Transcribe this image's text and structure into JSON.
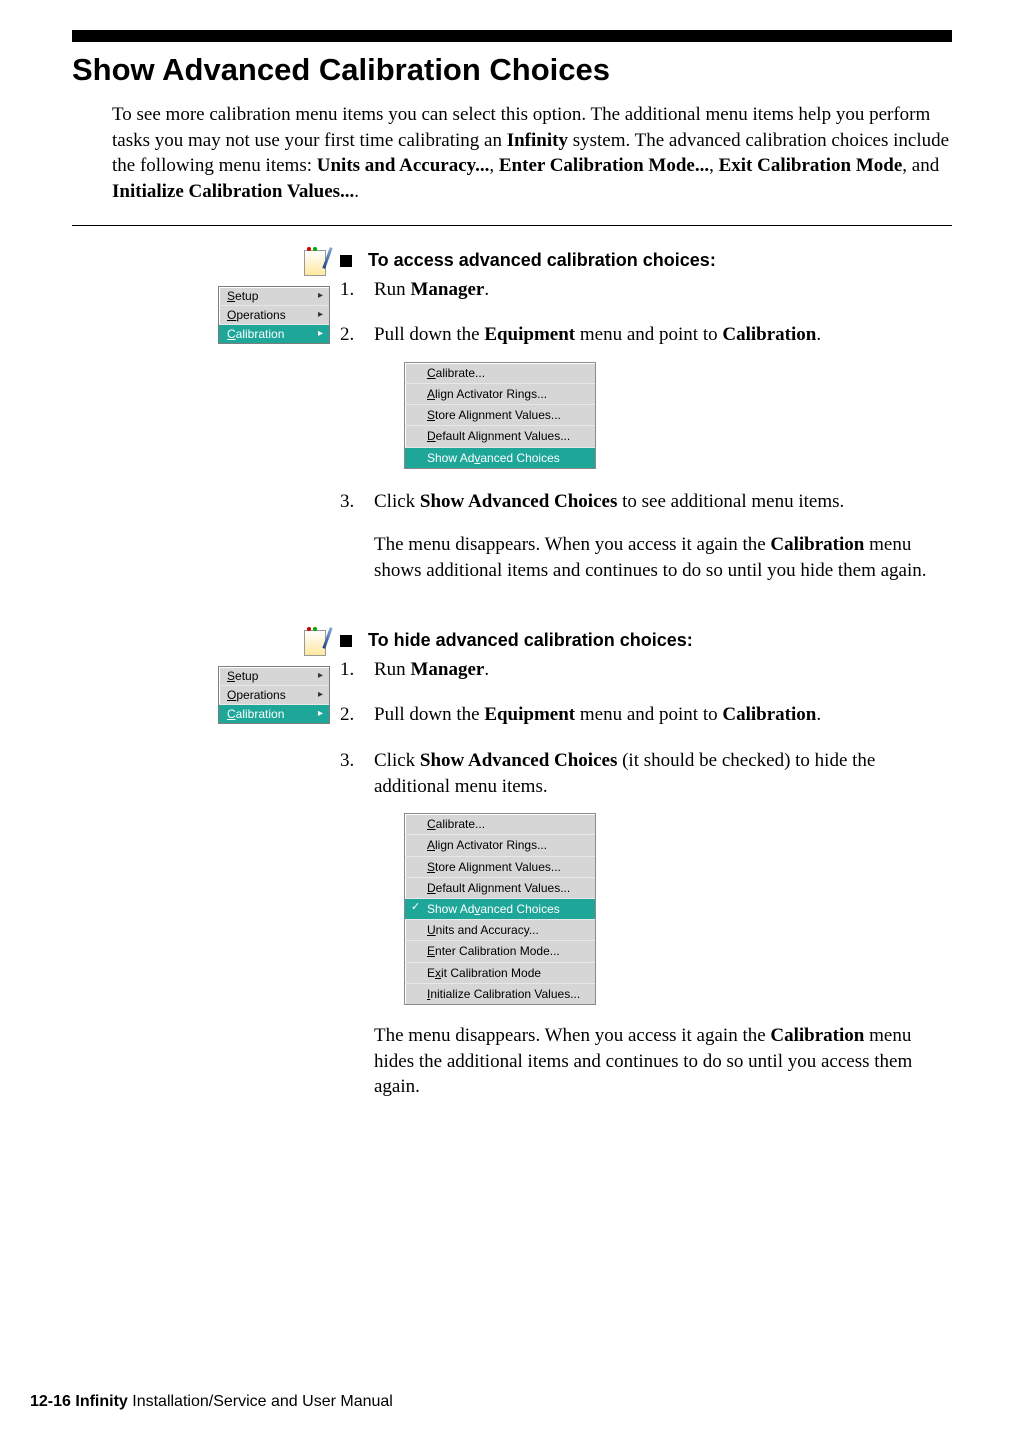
{
  "heading": "Show Advanced Calibration Choices",
  "intro": {
    "p1a": "To see more calibration menu items you can select this option. The additional menu items help you perform tasks you may not use your first time calibrating an ",
    "p1b": "Infinity",
    "p1c": " system. The advanced calibration choices include the following menu items: ",
    "m1": "Units and Accuracy...",
    "c1": ", ",
    "m2": "Enter Calibration Mode...",
    "c2": ", ",
    "m3": "Exit Calibration Mode",
    "c3": ", and ",
    "m4": "Initialize Calibration Values...",
    "c4": "."
  },
  "sideMenu": {
    "items": [
      "Setup",
      "Operations",
      "Calibration"
    ],
    "u": [
      "S",
      "O",
      "C"
    ]
  },
  "access": {
    "title": "To access advanced calibration choices:",
    "s1a": "Run ",
    "s1b": "Manager",
    "s1c": ".",
    "s2a": "Pull down the ",
    "s2b": "Equipment",
    "s2c": " menu and point to ",
    "s2d": "Calibration",
    "s2e": ".",
    "s3a": "Click ",
    "s3b": "Show Advanced Choices",
    "s3c": " to see additional menu items.",
    "s3pA": "The menu disappears. When you access it again the ",
    "s3pB": "Calibration",
    "s3pC": " menu shows additional items and continues to do so until you hide them again."
  },
  "subA": {
    "items": [
      "Calibrate...",
      "Align Activator Rings...",
      "Store Alignment Values...",
      "Default Alignment Values...",
      "Show Advanced Choices"
    ],
    "u": [
      "C",
      "A",
      "S",
      "D",
      "v"
    ]
  },
  "hide": {
    "title": "To hide advanced calibration choices:",
    "s1a": "Run ",
    "s1b": "Manager",
    "s1c": ".",
    "s2a": "Pull down the ",
    "s2b": "Equipment",
    "s2c": " menu and point to ",
    "s2d": "Calibration",
    "s2e": ".",
    "s3a": "Click ",
    "s3b": "Show Advanced Choices",
    "s3c": " (it should be checked) to hide the additional menu items.",
    "s3pA": "The menu disappears. When you access it again the ",
    "s3pB": "Calibration",
    "s3pC": " menu hides the additional items and continues to do so until you access them again."
  },
  "subB": {
    "items": [
      "Calibrate...",
      "Align Activator Rings...",
      "Store Alignment Values...",
      "Default Alignment Values...",
      "Show Advanced Choices",
      "Units and Accuracy...",
      "Enter Calibration Mode...",
      "Exit Calibration Mode",
      "Initialize Calibration Values..."
    ],
    "u": [
      "C",
      "A",
      "S",
      "D",
      "v",
      "U",
      "E",
      "x",
      "I"
    ]
  },
  "footer": {
    "page": "12-16",
    "sp": "  ",
    "bold": "Infinity",
    "rest": " Installation/Service and User Manual"
  }
}
